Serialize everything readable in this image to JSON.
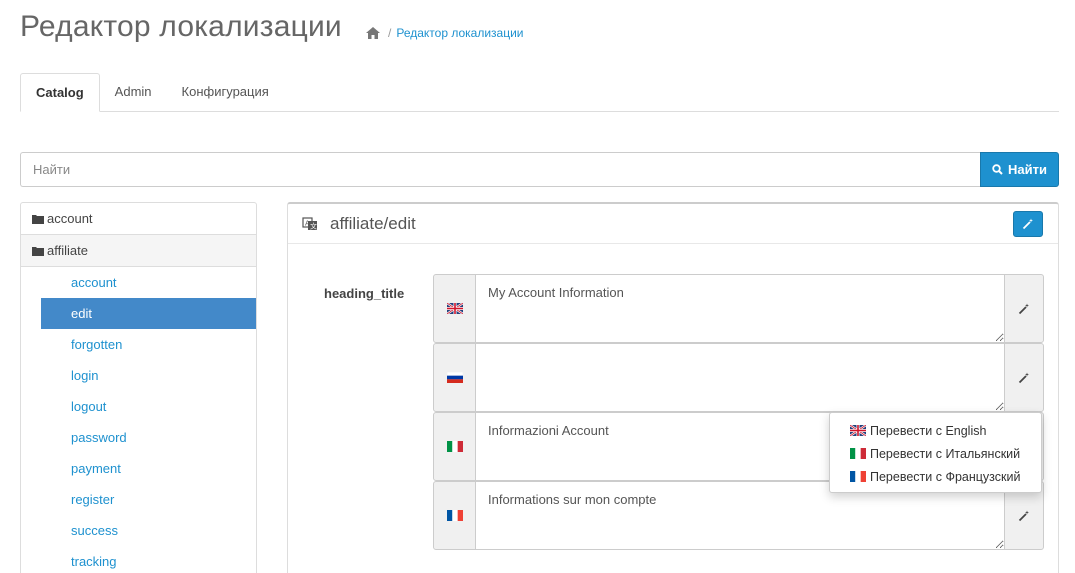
{
  "page": {
    "title": "Редактор локализации",
    "breadcrumb": "Редактор локализации"
  },
  "tabs": [
    "Catalog",
    "Admin",
    "Конфигурация"
  ],
  "search": {
    "placeholder": "Найти",
    "button_label": "Найти"
  },
  "tree": {
    "folders": [
      "account",
      "affiliate"
    ],
    "items": [
      "account",
      "edit",
      "forgotten",
      "login",
      "logout",
      "password",
      "payment",
      "register",
      "success",
      "tracking"
    ],
    "active_item": "edit"
  },
  "panel": {
    "title": "affiliate/edit",
    "field_label": "heading_title",
    "rows": [
      {
        "lang": "english",
        "value": "My Account Information"
      },
      {
        "lang": "russian",
        "value": ""
      },
      {
        "lang": "italian",
        "value": "Informazioni Account"
      },
      {
        "lang": "french",
        "value": "Informations sur mon compte"
      }
    ]
  },
  "dropdown": {
    "items": [
      "Перевести с English",
      "Перевести с Итальянский",
      "Перевести с Французский"
    ]
  },
  "colors": {
    "accent": "#1e91cf",
    "active_item": "#4389c9"
  }
}
